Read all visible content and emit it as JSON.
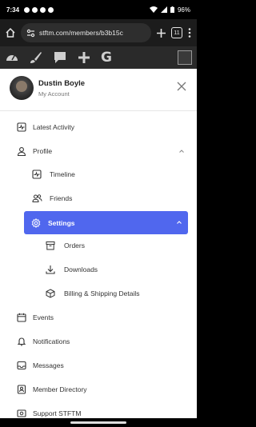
{
  "status": {
    "time": "7:34",
    "battery": "96%"
  },
  "browser": {
    "url": "stftm.com/members/b3b15c",
    "tabs_count": "11"
  },
  "profile": {
    "name": "Dustin Boyle",
    "subtitle": "My Account"
  },
  "menu": {
    "latest_activity": "Latest Activity",
    "profile": "Profile",
    "timeline": "Timeline",
    "friends": "Friends",
    "settings": "Settings",
    "orders": "Orders",
    "downloads": "Downloads",
    "billing": "Billing & Shipping Details",
    "events": "Events",
    "notifications": "Notifications",
    "messages": "Messages",
    "member_directory": "Member Directory",
    "support": "Support STFTM"
  },
  "colors": {
    "accent": "#5067ee",
    "browser_bar": "#1c1c1c",
    "site_bar": "#2a2a2a"
  },
  "icons": [
    "home-icon",
    "tune-icon",
    "plus-icon",
    "menu-icon",
    "dashboard-icon",
    "brush-icon",
    "chat-icon",
    "g-icon",
    "activity-icon",
    "user-icon",
    "users-icon",
    "gear-icon",
    "box-icon",
    "download-icon",
    "package-icon",
    "calendar-icon",
    "bell-icon",
    "inbox-icon",
    "id-card-icon",
    "support-icon",
    "close-icon",
    "chevron-up-icon"
  ]
}
